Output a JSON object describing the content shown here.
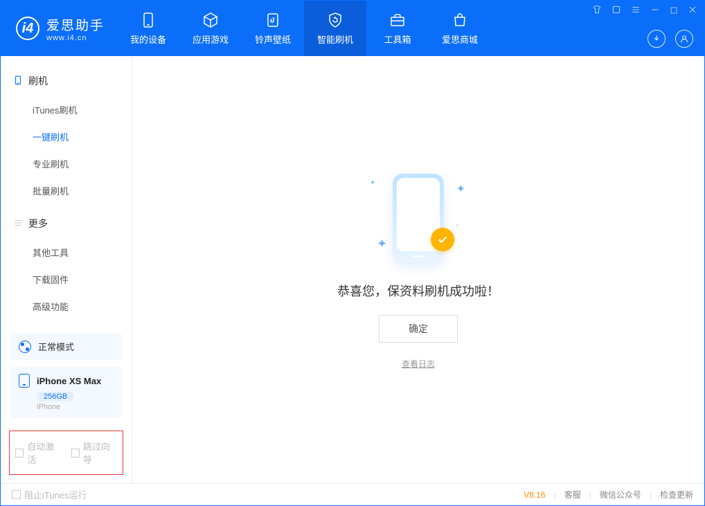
{
  "app": {
    "title": "爱思助手",
    "subtitle": "www.i4.cn"
  },
  "nav": {
    "device": "我的设备",
    "apps": "应用游戏",
    "ringtone": "铃声壁纸",
    "flash": "智能刷机",
    "toolbox": "工具箱",
    "store": "爱思商城"
  },
  "sidebar": {
    "section_flash": "刷机",
    "items_flash": [
      "iTunes刷机",
      "一键刷机",
      "专业刷机",
      "批量刷机"
    ],
    "section_more": "更多",
    "items_more": [
      "其他工具",
      "下载固件",
      "高级功能"
    ]
  },
  "device": {
    "mode": "正常模式",
    "name": "iPhone XS Max",
    "storage": "256GB",
    "type": "iPhone"
  },
  "options": {
    "auto_activate": "自动激活",
    "skip_guide": "跳过向导"
  },
  "main": {
    "success": "恭喜您，保资料刷机成功啦！",
    "ok": "确定",
    "view_log": "查看日志"
  },
  "footer": {
    "block_itunes": "阻止iTunes运行",
    "version": "V8.16",
    "support": "客服",
    "wechat": "微信公众号",
    "update": "检查更新"
  }
}
